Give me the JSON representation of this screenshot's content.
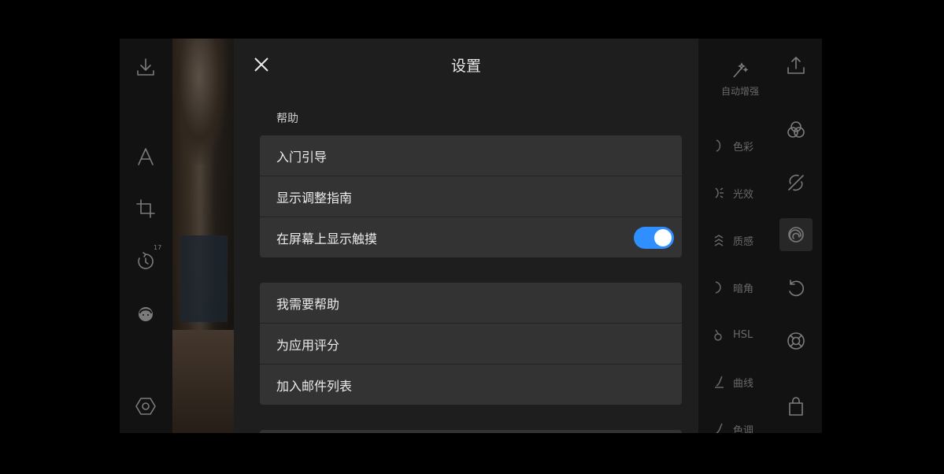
{
  "left_rail": {
    "buttons": [
      {
        "icon": "download-icon"
      },
      {
        "icon": "text-icon"
      },
      {
        "icon": "crop-icon"
      },
      {
        "icon": "history-icon",
        "badge": "17"
      },
      {
        "icon": "face-icon"
      },
      {
        "icon": "settings-hex-icon"
      }
    ]
  },
  "adjustments": {
    "auto_enhance": "自动增强",
    "items": [
      "色彩",
      "光效",
      "质感",
      "暗角",
      "HSL",
      "曲线",
      "色调"
    ]
  },
  "right_rail": {
    "buttons": [
      {
        "icon": "share-icon"
      },
      {
        "icon": "filters-icon"
      },
      {
        "icon": "healing-icon"
      },
      {
        "icon": "adjust-icon",
        "active": true
      },
      {
        "icon": "undo-icon"
      },
      {
        "icon": "help-lifebuoy-icon"
      },
      {
        "icon": "store-bag-icon"
      }
    ]
  },
  "settings": {
    "title": "设置",
    "help_section_label": "帮助",
    "group1": {
      "onboarding": "入门引导",
      "show_adjust_guide": "显示调整指南",
      "show_touches": "在屏幕上显示触摸",
      "show_touches_enabled": true
    },
    "group2": {
      "need_help": "我需要帮助",
      "rate_app": "为应用评分",
      "join_mailing_list": "加入邮件列表"
    }
  },
  "colors": {
    "toggle_on": "#2f8fff",
    "row_bg": "#333333"
  }
}
